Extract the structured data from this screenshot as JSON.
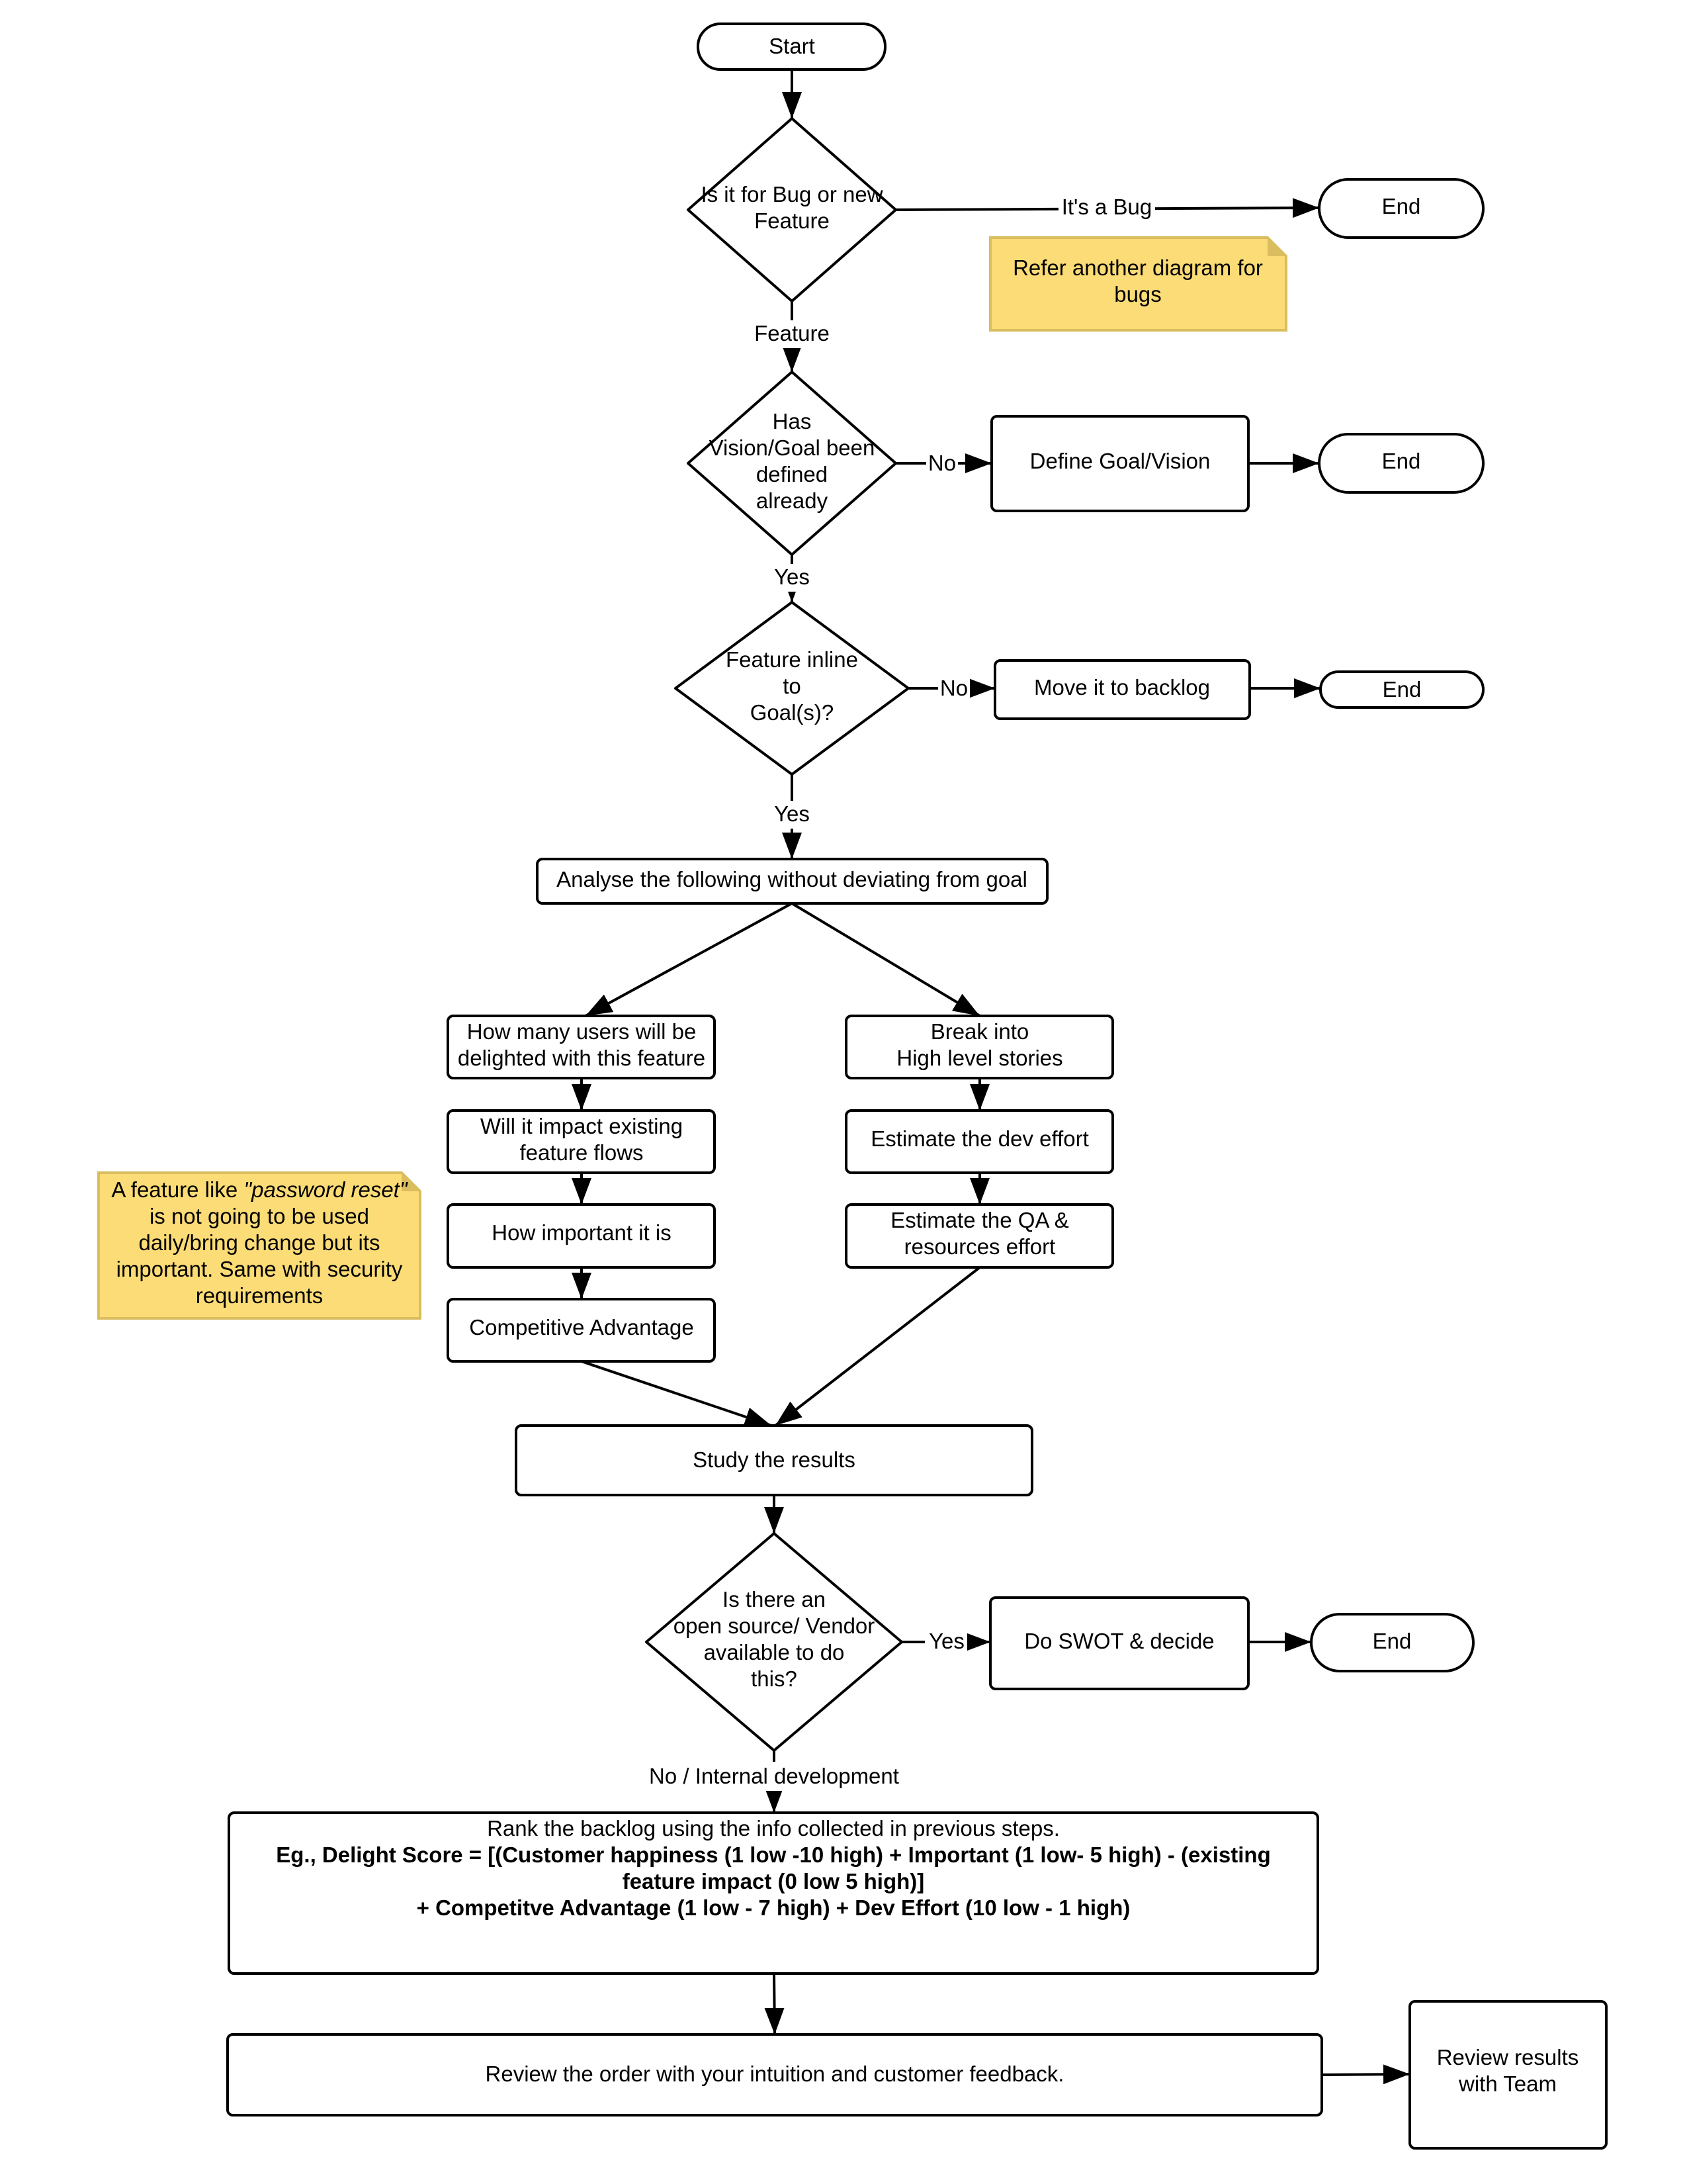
{
  "diagram": {
    "type": "flowchart",
    "nodes": {
      "start": {
        "label": "Start",
        "kind": "terminator"
      },
      "decision_bug_or_feature": {
        "lines": [
          "Is it for Bug or new",
          "Feature"
        ],
        "kind": "decision"
      },
      "end_bug": {
        "label": "End",
        "kind": "terminator"
      },
      "note_bugs": {
        "lines": [
          "Refer another diagram for",
          "bugs"
        ],
        "kind": "note"
      },
      "decision_vision": {
        "lines": [
          "Has",
          "Vision/Goal been",
          "defined",
          "already"
        ],
        "kind": "decision"
      },
      "define_goal": {
        "label": "Define Goal/Vision",
        "kind": "process"
      },
      "end_goal": {
        "label": "End",
        "kind": "terminator"
      },
      "decision_inline": {
        "lines": [
          "Feature inline",
          "to",
          "Goal(s)?"
        ],
        "kind": "decision"
      },
      "move_backlog": {
        "label": "Move it to backlog",
        "kind": "process"
      },
      "end_backlog": {
        "label": "End",
        "kind": "terminator"
      },
      "analyse": {
        "label": "Analyse the following without deviating from goal",
        "kind": "process"
      },
      "users_delighted": {
        "lines": [
          "How many users will be",
          "delighted with this feature"
        ],
        "kind": "process"
      },
      "impact_flows": {
        "lines": [
          "Will it impact existing",
          "feature flows"
        ],
        "kind": "process"
      },
      "how_important": {
        "label": "How important it is",
        "kind": "process"
      },
      "competitive": {
        "label": "Competitive Advantage",
        "kind": "process"
      },
      "break_stories": {
        "lines": [
          "Break into",
          "High level stories"
        ],
        "kind": "process"
      },
      "estimate_dev": {
        "label": "Estimate the dev effort",
        "kind": "process"
      },
      "estimate_qa": {
        "lines": [
          "Estimate the QA &",
          "resources effort"
        ],
        "kind": "process"
      },
      "note_password": {
        "line1_prefix": "A feature like ",
        "line1_italic": "\"password reset\"",
        "lines": [
          "is not going to be used",
          "daily/bring change  but its",
          "important. Same with security",
          "requirements"
        ],
        "kind": "note"
      },
      "study_results": {
        "label": "Study the results",
        "kind": "process"
      },
      "decision_vendor": {
        "lines": [
          "Is there an",
          "open source/ Vendor",
          "available to do",
          "this?"
        ],
        "kind": "decision"
      },
      "swot": {
        "label": "Do SWOT  & decide",
        "kind": "process"
      },
      "end_swot": {
        "label": "End",
        "kind": "terminator"
      },
      "rank_backlog": {
        "line1": "Rank the backlog using the info collected in previous steps.",
        "bold_lines": [
          "Eg., Delight Score = [(Customer happiness (1 low -10 high) + Important (1 low- 5 high) - (existing",
          "feature impact (0 low 5 high)]",
          "+ Competitve Advantage (1 low - 7 high) + Dev Effort (10 low - 1 high)"
        ],
        "kind": "process"
      },
      "review_order": {
        "label": "Review the order with your intuition and customer feedback.",
        "kind": "process"
      },
      "review_team": {
        "lines": [
          "Review results",
          "with Team"
        ],
        "kind": "process"
      }
    },
    "edge_labels": {
      "its_a_bug": "It's a Bug",
      "feature": "Feature",
      "no_vision": "No",
      "yes_vision": "Yes",
      "no_inline": "No",
      "yes_inline": "Yes",
      "yes_vendor": "Yes",
      "no_internal": "No / Internal development"
    },
    "colors": {
      "note_fill": "#fcdc76",
      "note_border": "#d9bd5e",
      "stroke": "#000000",
      "background": "#ffffff"
    }
  }
}
